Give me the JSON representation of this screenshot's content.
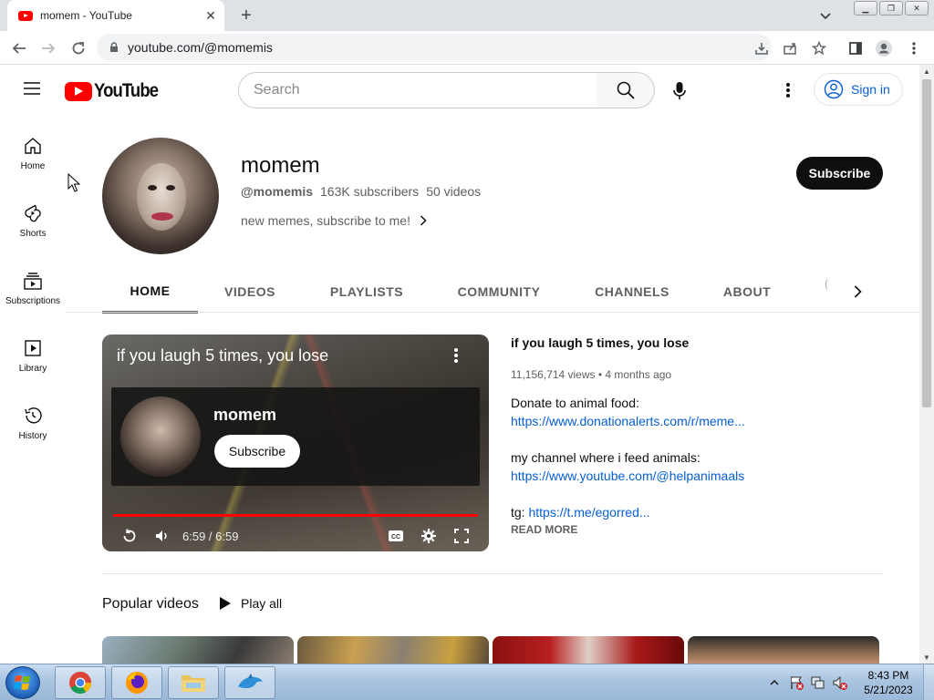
{
  "browser": {
    "tab_title": "momem - YouTube",
    "url": "youtube.com/@momemis"
  },
  "youtube": {
    "logo_text": "YouTube",
    "search_placeholder": "Search",
    "sign_in": "Sign in",
    "sidebar": [
      {
        "label": "Home",
        "icon": "home-icon"
      },
      {
        "label": "Shorts",
        "icon": "shorts-icon"
      },
      {
        "label": "Subscriptions",
        "icon": "subscriptions-icon"
      },
      {
        "label": "Library",
        "icon": "library-icon"
      },
      {
        "label": "History",
        "icon": "history-icon"
      }
    ],
    "channel": {
      "name": "momem",
      "handle": "@momemis",
      "subscribers": "163K subscribers",
      "videos": "50 videos",
      "description": "new memes, subscribe to me!",
      "subscribe_label": "Subscribe"
    },
    "tabs": [
      "HOME",
      "VIDEOS",
      "PLAYLISTS",
      "COMMUNITY",
      "CHANNELS",
      "ABOUT"
    ],
    "tab_overflow_glyph": "(",
    "player": {
      "title": "if you laugh 5 times, you lose",
      "endcard_name": "momem",
      "endcard_subscribe": "Subscribe",
      "time": "6:59 / 6:59",
      "progress_fraction": 1.0
    },
    "video_info": {
      "title": "if you laugh 5 times, you lose",
      "meta": "11,156,714 views • 4 months ago",
      "donate_label": "Donate to animal food:",
      "donate_link": "https://www.donationalerts.com/r/meme...",
      "feed_label": "my channel where i feed animals:",
      "feed_link": "https://www.youtube.com/@helpanimaals",
      "tg_label": "tg:",
      "tg_link": "https://t.me/egorred...",
      "read_more": "READ MORE"
    },
    "popular_title": "Popular videos",
    "play_all": "Play all"
  },
  "taskbar": {
    "time": "8:43 PM",
    "date": "5/21/2023"
  },
  "colors": {
    "youtube_red": "#ff0000",
    "link_blue": "#065fd4",
    "subscribe_black": "#0f0f0f"
  }
}
